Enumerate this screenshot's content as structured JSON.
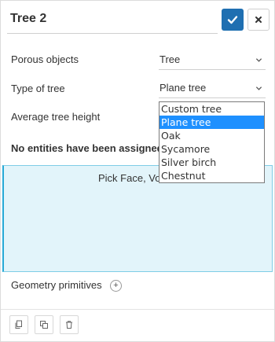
{
  "header": {
    "title": "Tree 2"
  },
  "fields": {
    "porous_objects": {
      "label": "Porous objects",
      "value": "Tree"
    },
    "type_of_tree": {
      "label": "Type of tree",
      "value": "Plane tree"
    },
    "average_height": {
      "label": "Average tree height"
    }
  },
  "assignment": {
    "status": "No entities have been assigned",
    "hint": "Pick Face, Volu"
  },
  "geometry": {
    "label": "Geometry primitives",
    "add_symbol": "+"
  },
  "dropdown": {
    "options": [
      "Custom tree",
      "Plane tree",
      "Oak",
      "Sycamore",
      "Silver birch",
      "Chestnut"
    ],
    "selected": "Plane tree"
  },
  "icons": {
    "confirm": "check-icon",
    "close": "close-icon",
    "tools": [
      "copy-icon",
      "duplicate-icon",
      "trash-icon"
    ]
  },
  "colors": {
    "accent": "#1f6fb1",
    "selection": "#1e90ff",
    "assign_bg": "#e2f4fa",
    "assign_border": "#27a9d6"
  }
}
